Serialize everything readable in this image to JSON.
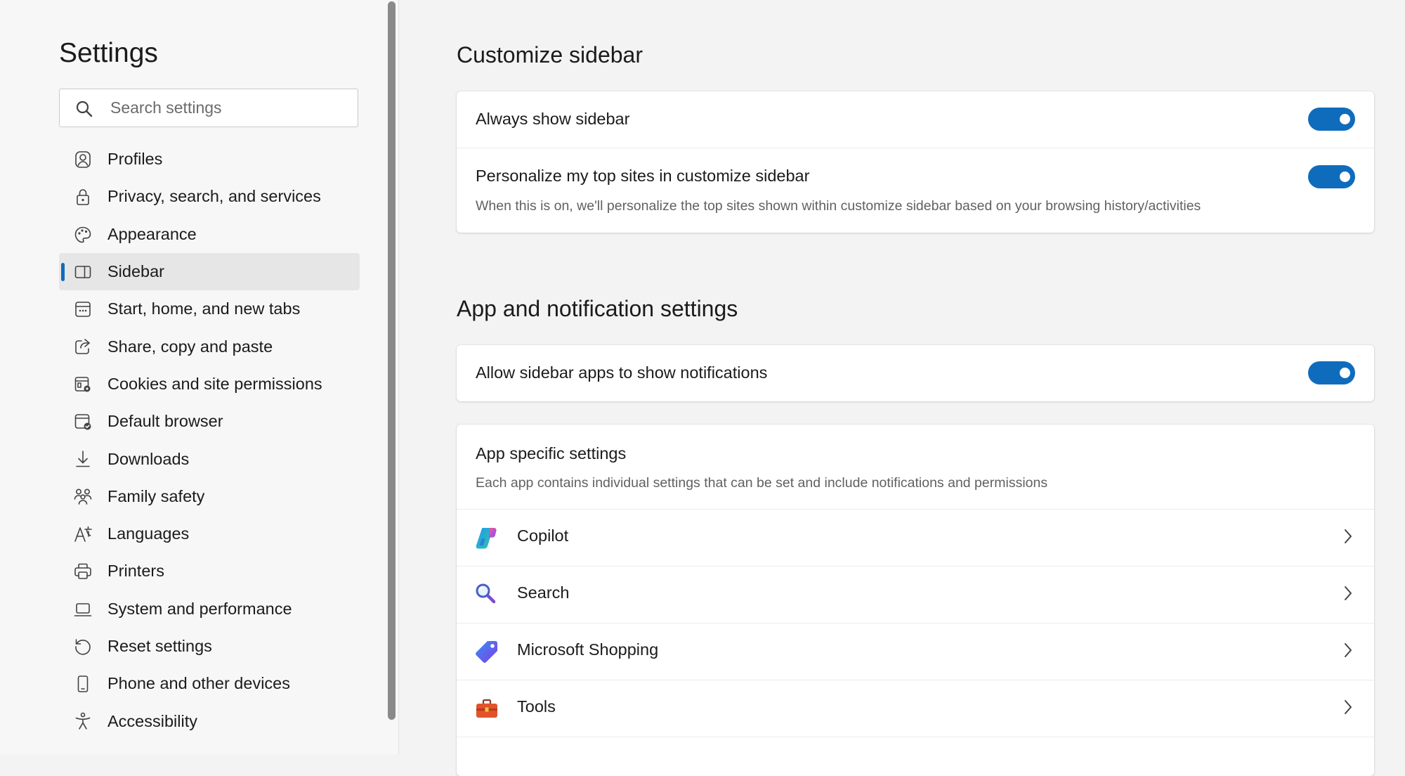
{
  "nav": {
    "title": "Settings",
    "search_placeholder": "Search settings",
    "items": [
      {
        "label": "Profiles",
        "icon": "profile-icon",
        "active": false
      },
      {
        "label": "Privacy, search, and services",
        "icon": "lock-icon",
        "active": false
      },
      {
        "label": "Appearance",
        "icon": "palette-icon",
        "active": false
      },
      {
        "label": "Sidebar",
        "icon": "sidebar-icon",
        "active": true
      },
      {
        "label": "Start, home, and new tabs",
        "icon": "home-tabs-icon",
        "active": false
      },
      {
        "label": "Share, copy and paste",
        "icon": "share-icon",
        "active": false
      },
      {
        "label": "Cookies and site permissions",
        "icon": "cookies-icon",
        "active": false
      },
      {
        "label": "Default browser",
        "icon": "browser-icon",
        "active": false
      },
      {
        "label": "Downloads",
        "icon": "download-icon",
        "active": false
      },
      {
        "label": "Family safety",
        "icon": "family-icon",
        "active": false
      },
      {
        "label": "Languages",
        "icon": "languages-icon",
        "active": false
      },
      {
        "label": "Printers",
        "icon": "printer-icon",
        "active": false
      },
      {
        "label": "System and performance",
        "icon": "laptop-icon",
        "active": false
      },
      {
        "label": "Reset settings",
        "icon": "reset-icon",
        "active": false
      },
      {
        "label": "Phone and other devices",
        "icon": "phone-icon",
        "active": false
      },
      {
        "label": "Accessibility",
        "icon": "accessibility-icon",
        "active": false
      }
    ]
  },
  "customize": {
    "title": "Customize sidebar",
    "always_show": {
      "label": "Always show sidebar",
      "enabled": true
    },
    "personalize": {
      "label": "Personalize my top sites in customize sidebar",
      "description": "When this is on, we'll personalize the top sites shown within customize sidebar based on your browsing history/activities",
      "enabled": true
    }
  },
  "app_notifications": {
    "title": "App and notification settings",
    "allow_notifications": {
      "label": "Allow sidebar apps to show notifications",
      "enabled": true
    },
    "app_specific": {
      "label": "App specific settings",
      "description": "Each app contains individual settings that can be set and include notifications and permissions",
      "apps": [
        {
          "label": "Copilot",
          "icon": "copilot-icon"
        },
        {
          "label": "Search",
          "icon": "magnifier-icon"
        },
        {
          "label": "Microsoft Shopping",
          "icon": "shopping-tag-icon"
        },
        {
          "label": "Tools",
          "icon": "toolbox-icon"
        }
      ]
    }
  },
  "colors": {
    "accent": "#0f6cbd",
    "background": "#f3f3f3",
    "nav_active": "#e6e6e6"
  }
}
